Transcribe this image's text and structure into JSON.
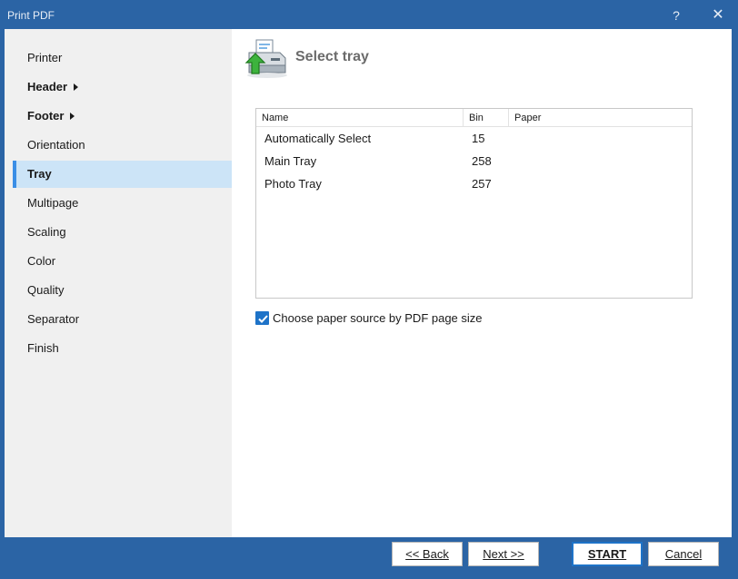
{
  "window": {
    "title": "Print PDF",
    "help_glyph": "?",
    "close_glyph": "✕",
    "accent_color": "#2b64a5"
  },
  "sidebar": {
    "items": [
      {
        "label": "Printer",
        "bold": false,
        "submenu": false,
        "active": false
      },
      {
        "label": "Header",
        "bold": true,
        "submenu": true,
        "active": false
      },
      {
        "label": "Footer",
        "bold": true,
        "submenu": true,
        "active": false
      },
      {
        "label": "Orientation",
        "bold": false,
        "submenu": false,
        "active": false
      },
      {
        "label": "Tray",
        "bold": true,
        "submenu": false,
        "active": true
      },
      {
        "label": "Multipage",
        "bold": false,
        "submenu": false,
        "active": false
      },
      {
        "label": "Scaling",
        "bold": false,
        "submenu": false,
        "active": false
      },
      {
        "label": "Color",
        "bold": false,
        "submenu": false,
        "active": false
      },
      {
        "label": "Quality",
        "bold": false,
        "submenu": false,
        "active": false
      },
      {
        "label": "Separator",
        "bold": false,
        "submenu": false,
        "active": false
      },
      {
        "label": "Finish",
        "bold": false,
        "submenu": false,
        "active": false
      }
    ]
  },
  "content": {
    "title": "Select tray",
    "icon": "printer-upload-icon",
    "table": {
      "columns": [
        "Name",
        "Bin",
        "Paper"
      ],
      "rows": [
        {
          "name": "Automatically Select",
          "bin": "15",
          "paper": ""
        },
        {
          "name": "Main Tray",
          "bin": "258",
          "paper": ""
        },
        {
          "name": "Photo Tray",
          "bin": "257",
          "paper": ""
        }
      ]
    },
    "checkbox": {
      "label": "Choose paper source by PDF page size",
      "checked": true
    }
  },
  "footer": {
    "back_label": "<< Back",
    "next_label": "Next >>",
    "start_label": "START",
    "cancel_label": "Cancel"
  }
}
